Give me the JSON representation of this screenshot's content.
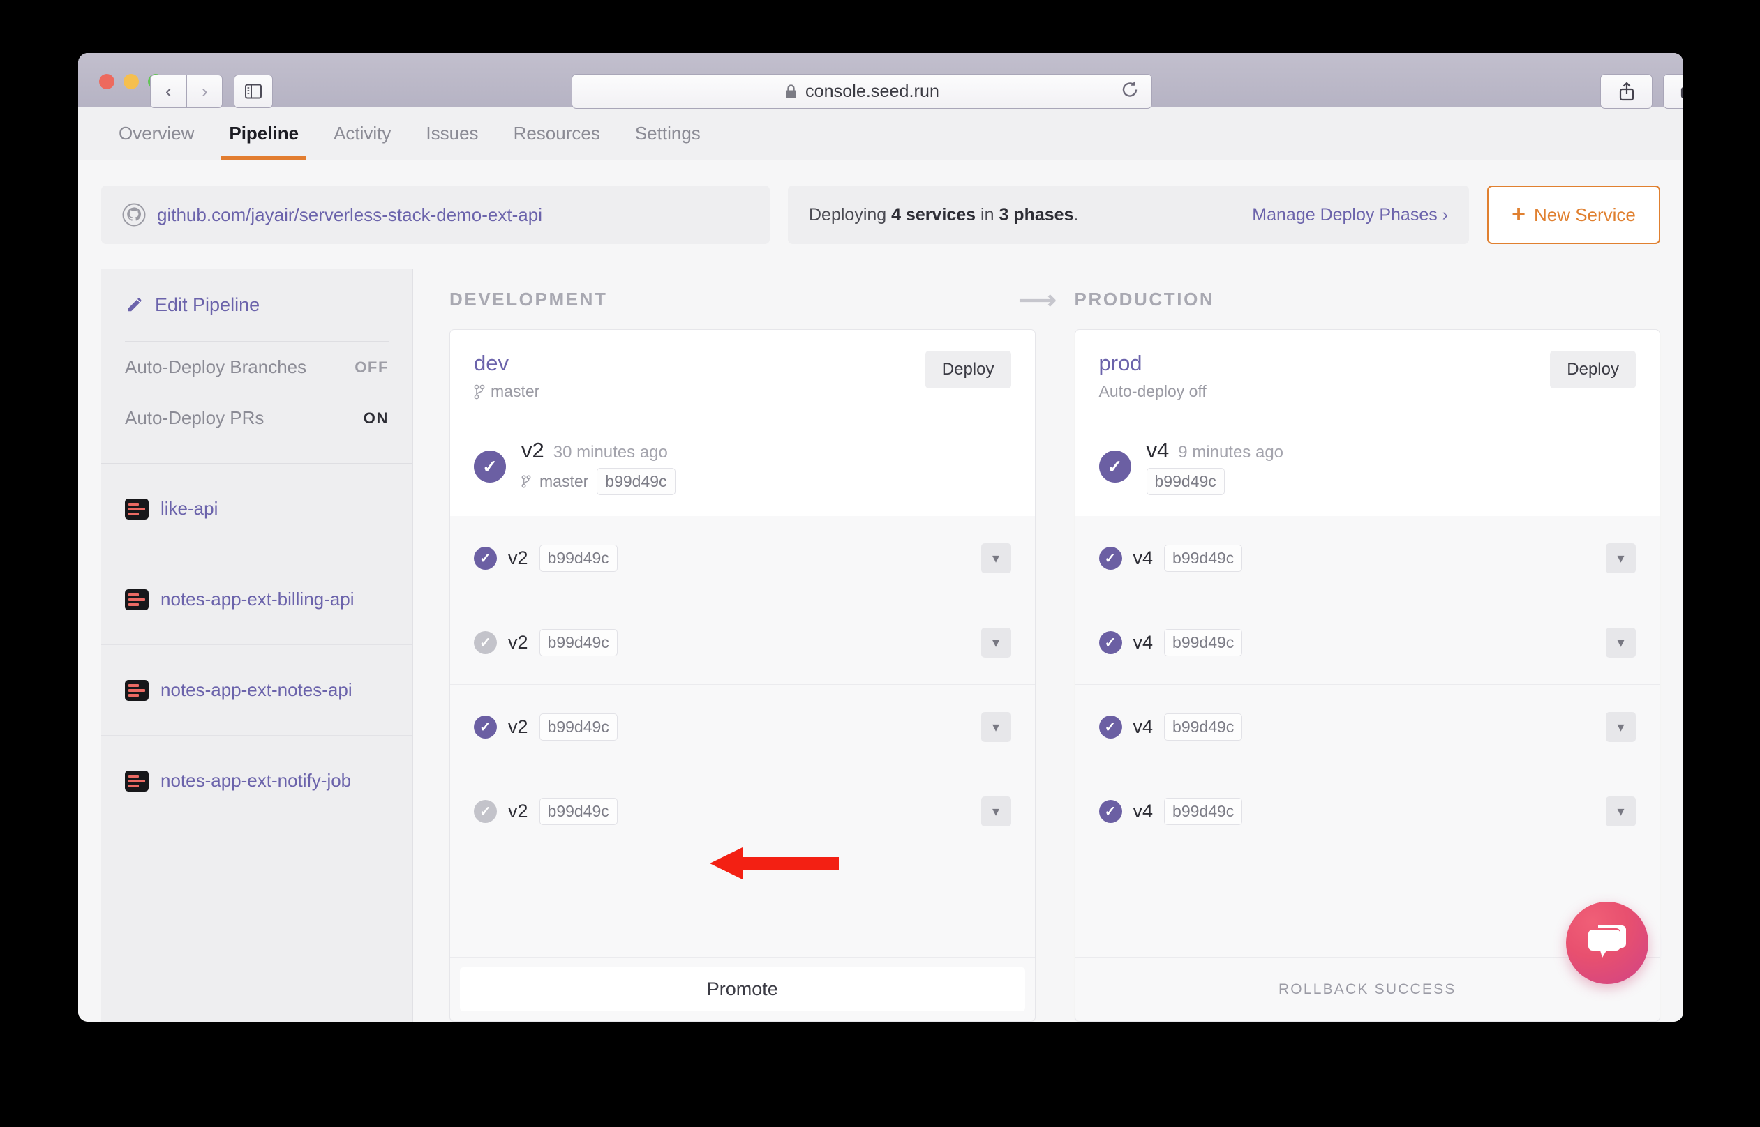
{
  "browser": {
    "url": "console.seed.run",
    "lock_icon": "lock-icon",
    "back_icon": "chevron-left-icon",
    "forward_icon": "chevron-right-icon",
    "sidebar_icon": "sidebar-toggle-icon",
    "reload_icon": "reload-icon",
    "share_icon": "share-icon",
    "tabs_icon": "show-tabs-icon",
    "newtab_label": "+"
  },
  "nav": {
    "tabs": [
      {
        "label": "Overview",
        "active": false
      },
      {
        "label": "Pipeline",
        "active": true
      },
      {
        "label": "Activity",
        "active": false
      },
      {
        "label": "Issues",
        "active": false
      },
      {
        "label": "Resources",
        "active": false
      },
      {
        "label": "Settings",
        "active": false
      }
    ]
  },
  "banner": {
    "repo_icon": "github-icon",
    "repo_url": "github.com/jayair/serverless-stack-demo-ext-api",
    "deploy_summary_prefix": "Deploying ",
    "deploy_services_count": "4 services",
    "deploy_middle": " in ",
    "deploy_phases_count": "3 phases",
    "deploy_suffix": ".",
    "manage_link": "Manage Deploy Phases ›",
    "new_service_plus": "+",
    "new_service_label": "New Service",
    "accent_orange": "#e08030"
  },
  "sidebar": {
    "edit_pipeline_icon": "pencil-icon",
    "edit_pipeline_label": "Edit Pipeline",
    "settings": [
      {
        "label": "Auto-Deploy Branches",
        "value": "OFF",
        "state": "off"
      },
      {
        "label": "Auto-Deploy PRs",
        "value": "ON",
        "state": "on"
      }
    ],
    "services": [
      {
        "label": "like-api",
        "icon": "service-icon"
      },
      {
        "label": "notes-app-ext-billing-api",
        "icon": "service-icon"
      },
      {
        "label": "notes-app-ext-notes-api",
        "icon": "service-icon"
      },
      {
        "label": "notes-app-ext-notify-job",
        "icon": "service-icon"
      }
    ]
  },
  "stages": [
    {
      "heading": "DEVELOPMENT",
      "name": "dev",
      "sub": "master",
      "sub_icon": "git-branch-icon",
      "deploy_label": "Deploy",
      "head_build": {
        "status": "ok",
        "version": "v2",
        "time": "30 minutes ago",
        "branch": "master",
        "branch_icon": "git-branch-icon",
        "hash": "b99d49c"
      },
      "rows": [
        {
          "status": "ok",
          "version": "v2",
          "hash": "b99d49c",
          "chevron": "chevron-down-icon"
        },
        {
          "status": "idle",
          "version": "v2",
          "hash": "b99d49c",
          "chevron": "chevron-down-icon"
        },
        {
          "status": "ok",
          "version": "v2",
          "hash": "b99d49c",
          "chevron": "chevron-down-icon"
        },
        {
          "status": "idle",
          "version": "v2",
          "hash": "b99d49c",
          "chevron": "chevron-down-icon"
        }
      ],
      "footer_kind": "button",
      "footer_label": "Promote"
    },
    {
      "heading": "PRODUCTION",
      "name": "prod",
      "sub": "Auto-deploy off",
      "sub_icon": "",
      "deploy_label": "Deploy",
      "head_build": {
        "status": "ok",
        "version": "v4",
        "time": "9 minutes ago",
        "branch": "",
        "branch_icon": "",
        "hash": "b99d49c"
      },
      "rows": [
        {
          "status": "ok",
          "version": "v4",
          "hash": "b99d49c",
          "chevron": "chevron-down-icon"
        },
        {
          "status": "ok",
          "version": "v4",
          "hash": "b99d49c",
          "chevron": "chevron-down-icon"
        },
        {
          "status": "ok",
          "version": "v4",
          "hash": "b99d49c",
          "chevron": "chevron-down-icon"
        },
        {
          "status": "ok",
          "version": "v4",
          "hash": "b99d49c",
          "chevron": "chevron-down-icon"
        }
      ],
      "footer_kind": "label",
      "footer_label": "ROLLBACK SUCCESS"
    }
  ],
  "stage_flow_arrow_icon": "arrow-right-icon",
  "annotation": {
    "arrow_icon": "red-pointer-arrow",
    "color": "#f32013",
    "points_at": "dev service row 2"
  },
  "chat": {
    "icon": "chat-bubble-icon",
    "color": "#e8506f"
  },
  "colors": {
    "accent_purple": "#6b5fa3",
    "accent_orange": "#e08030",
    "link_purple": "#6b63ab",
    "idle_grey": "#c3c3ca"
  }
}
